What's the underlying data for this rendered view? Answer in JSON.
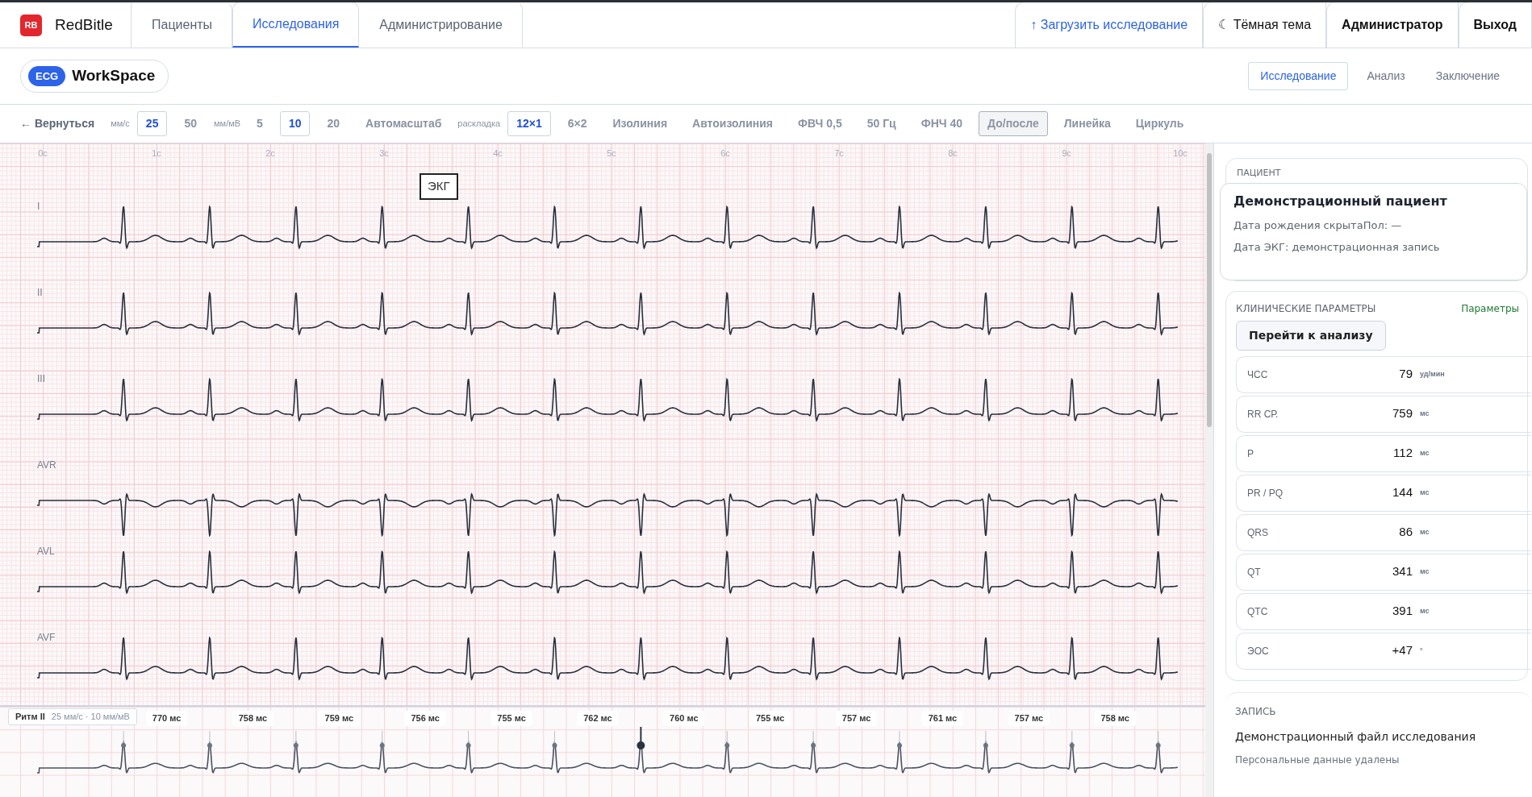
{
  "brand": {
    "logo": "RB",
    "name": "RedBitle"
  },
  "nav_tabs": [
    {
      "label": "Пациенты",
      "selected": false
    },
    {
      "label": "Исследования",
      "selected": true
    },
    {
      "label": "Администрирование",
      "selected": false
    }
  ],
  "header_actions": [
    {
      "kind": "upload",
      "label": "↑ Загрузить исследование"
    },
    {
      "kind": "theme",
      "label": "☾ Тёмная тема"
    },
    {
      "kind": "user",
      "label": "Администратор"
    },
    {
      "kind": "logout",
      "label": "Выход"
    }
  ],
  "workspace": {
    "badge": "ECG",
    "title": "WorkSpace"
  },
  "view_tabs": [
    {
      "label": "Исследование",
      "selected": true
    },
    {
      "label": "Анализ",
      "selected": false
    },
    {
      "label": "Заключение",
      "selected": false
    }
  ],
  "toolbar": [
    {
      "kind": "back",
      "text": "← Вернуться"
    },
    {
      "kind": "caption",
      "text": "мм/с"
    },
    {
      "kind": "option",
      "text": "25",
      "selected": true
    },
    {
      "kind": "option",
      "text": "50",
      "selected": false
    },
    {
      "kind": "caption",
      "text": "мм/мВ"
    },
    {
      "kind": "option",
      "text": "5",
      "selected": false
    },
    {
      "kind": "option",
      "text": "10",
      "selected": true
    },
    {
      "kind": "option",
      "text": "20",
      "selected": false
    },
    {
      "kind": "tool",
      "text": "Автомасштаб",
      "disabled": false
    },
    {
      "kind": "caption",
      "text": "раскладка"
    },
    {
      "kind": "option",
      "text": "12×1",
      "selected": true
    },
    {
      "kind": "option",
      "text": "6×2",
      "selected": false
    },
    {
      "kind": "tool",
      "text": "Изолиния",
      "disabled": false
    },
    {
      "kind": "tool",
      "text": "Автоизолиния",
      "disabled": false
    },
    {
      "kind": "tool",
      "text": "ФВЧ 0,5",
      "disabled": false
    },
    {
      "kind": "tool",
      "text": "50 Гц",
      "disabled": false
    },
    {
      "kind": "tool",
      "text": "ФНЧ 40",
      "disabled": false
    },
    {
      "kind": "tool",
      "text": "До/после",
      "disabled": true
    },
    {
      "kind": "tool",
      "text": "Линейка",
      "disabled": false
    },
    {
      "kind": "tool",
      "text": "Циркуль",
      "disabled": false
    }
  ],
  "ecg": {
    "time_labels": [
      "0с",
      "1с",
      "2с",
      "3с",
      "4с",
      "5с",
      "6с",
      "7с",
      "8с",
      "9с",
      "10с"
    ],
    "annotation": "ЭКГ",
    "leads": [
      {
        "label": "I",
        "inverted": false
      },
      {
        "label": "II",
        "inverted": false
      },
      {
        "label": "III",
        "inverted": false
      },
      {
        "label": "AVR",
        "inverted": true
      },
      {
        "label": "AVL",
        "inverted": false
      },
      {
        "label": "AVF",
        "inverted": false
      }
    ]
  },
  "rhythm_strip": {
    "label": "Ритм II",
    "settings": "25 мм/с · 10 мм/мВ",
    "intervals": [
      "770 мс",
      "758 мс",
      "759 мс",
      "756 мс",
      "755 мс",
      "762 мс",
      "760 мс",
      "755 мс",
      "757 мс",
      "761 мс",
      "757 мс",
      "758 мс"
    ],
    "beats": [
      {
        "selected": false
      },
      {
        "selected": false
      },
      {
        "selected": false
      },
      {
        "selected": false
      },
      {
        "selected": false
      },
      {
        "selected": false
      },
      {
        "selected": true
      },
      {
        "selected": false
      },
      {
        "selected": false
      },
      {
        "selected": false
      },
      {
        "selected": false
      },
      {
        "selected": false
      },
      {
        "selected": false
      }
    ]
  },
  "patient": {
    "section": "ПАЦИЕНТ",
    "name": "Демонстрационный пациент",
    "birth": "Дата рождения скрыта",
    "sex": "Пол: —",
    "ecg_date": "Дата ЭКГ: демонстрационная запись"
  },
  "parameters": {
    "title": "КЛИНИЧЕСКИЕ ПАРАМЕТРЫ",
    "link": "Параметры",
    "button": "Перейти к анализу",
    "rows": [
      {
        "name": "ЧСС",
        "value": "79",
        "unit": "уд/мин"
      },
      {
        "name": "RR СР.",
        "value": "759",
        "unit": "мс"
      },
      {
        "name": "P",
        "value": "112",
        "unit": "мс"
      },
      {
        "name": "PR / PQ",
        "value": "144",
        "unit": "мс"
      },
      {
        "name": "QRS",
        "value": "86",
        "unit": "мс"
      },
      {
        "name": "QT",
        "value": "341",
        "unit": "мс"
      },
      {
        "name": "QTC",
        "value": "391",
        "unit": "мс"
      },
      {
        "name": "ЭОС",
        "value": "+47",
        "unit": "°"
      }
    ]
  },
  "record": {
    "title": "ЗАПИСЬ",
    "file": "Демонстрационный файл исследования",
    "note": "Персональные данные удалены"
  }
}
